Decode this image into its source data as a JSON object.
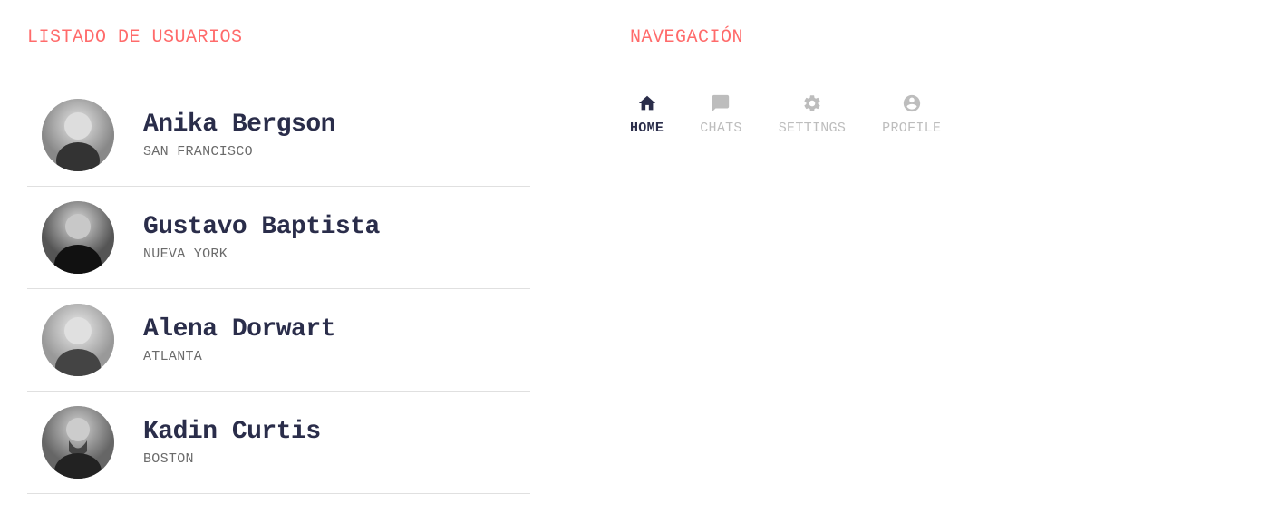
{
  "leftPanel": {
    "title": "LISTADO DE USUARIOS",
    "users": [
      {
        "name": "Anika Bergson",
        "location": "SAN FRANCISCO"
      },
      {
        "name": "Gustavo Baptista",
        "location": "NUEVA YORK"
      },
      {
        "name": "Alena Dorwart",
        "location": "ATLANTA"
      },
      {
        "name": "Kadin Curtis",
        "location": "BOSTON"
      }
    ]
  },
  "rightPanel": {
    "title": "NAVEGACIÓN",
    "nav": [
      {
        "label": "HOME",
        "icon": "home",
        "active": true
      },
      {
        "label": "CHATS",
        "icon": "chat",
        "active": false
      },
      {
        "label": "SETTINGS",
        "icon": "settings",
        "active": false
      },
      {
        "label": "PROFILE",
        "icon": "profile",
        "active": false
      }
    ]
  }
}
